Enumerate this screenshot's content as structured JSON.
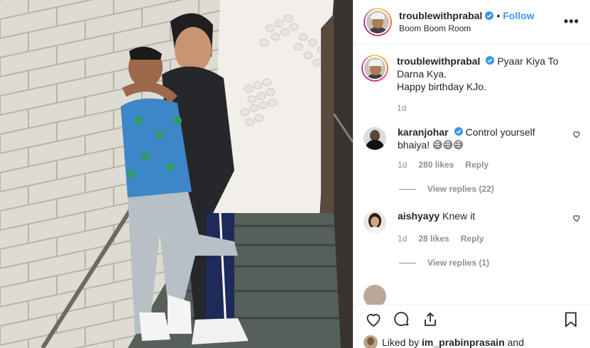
{
  "post": {
    "username": "troublewithprabal",
    "follow_label": "Follow",
    "dot": "•",
    "location": "Boom Boom Room",
    "more_icon": "more-horizontal-icon",
    "more_label": "•••"
  },
  "caption": {
    "username": "troublewithprabal",
    "text": "Pyaar Kiya To Darna Kya. Happy birthday KJo.",
    "line1": "Pyaar Kiya To",
    "line2": "Darna Kya.",
    "line3": "Happy birthday KJo.",
    "time": "1d"
  },
  "comments": [
    {
      "username": "karanjohar",
      "verified": true,
      "text_line1": "Control yourself",
      "text_line2": "bhaiya! 😅😅😅",
      "time": "1d",
      "likes": "280 likes",
      "reply_label": "Reply",
      "view_replies": "View replies (22)"
    },
    {
      "username": "aishyayy",
      "verified": false,
      "text_line1": "Knew it",
      "time": "1d",
      "likes": "28 likes",
      "reply_label": "Reply",
      "view_replies": "View replies (1)"
    }
  ],
  "actions": {
    "like_icon": "heart-icon",
    "comment_icon": "comment-icon",
    "share_icon": "share-icon",
    "save_icon": "bookmark-icon"
  },
  "liked_by": {
    "prefix": "Liked by",
    "username": "im_prabinprasain",
    "suffix": "and"
  },
  "colors": {
    "link_blue": "#3897f0",
    "verified_blue": "#3897f0",
    "text": "#262626",
    "muted": "#8e8e8e",
    "border": "#efefef"
  }
}
